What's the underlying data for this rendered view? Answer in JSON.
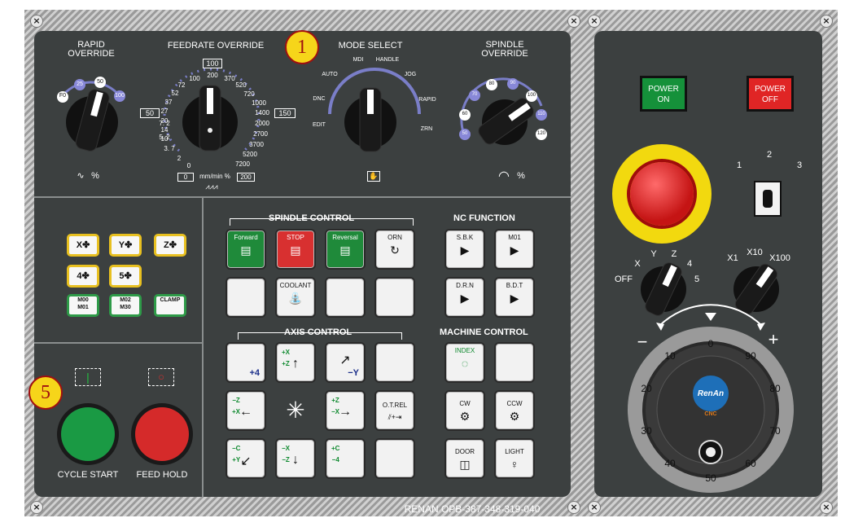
{
  "top_panel": {
    "rapid_override": {
      "title": "RAPID\nOVERRIDE",
      "scale": [
        "F0",
        "25",
        "50",
        "100"
      ],
      "unit": "%"
    },
    "feedrate_override": {
      "title": "FEEDRATE OVERRIDE",
      "top_box": "100",
      "left_box": "50",
      "right_box": "150",
      "left_scale": [
        "72",
        "52",
        "37",
        "27",
        "20",
        "14",
        "10",
        "7. 2",
        "5. 2",
        "3. 7",
        "2",
        "0"
      ],
      "top_scale": [
        "100",
        "200",
        "370",
        "520",
        "720",
        "1000",
        "1400",
        "2000",
        "2700",
        "3700",
        "5200",
        "7200"
      ],
      "bottom_left_box": "0",
      "unit": "mm/min %",
      "bottom_right_box": "200"
    },
    "mode_select": {
      "title": "MODE SELECT",
      "modes": [
        "AUTO",
        "MDI",
        "HANDLE",
        "JOG",
        "RAPID",
        "ZRN",
        "EDIT",
        "DNC"
      ]
    },
    "spindle_override": {
      "title": "SPINDLE\nOVERRIDE",
      "scale": [
        "50",
        "60",
        "70",
        "80",
        "90",
        "100",
        "110",
        "120"
      ],
      "unit": "%"
    }
  },
  "right_panel": {
    "power_on": "POWER\nON",
    "power_off": "POWER\nOFF",
    "key_switch": [
      "1",
      "2",
      "3"
    ],
    "axis_select": [
      "OFF",
      "X",
      "Y",
      "Z",
      "4",
      "5"
    ],
    "mult_select": [
      "X1",
      "X10",
      "X100"
    ],
    "hand_wheel": {
      "minus": "−",
      "plus": "+",
      "brand": "RenAn",
      "sub": "CNC",
      "ticks": [
        "0",
        "10",
        "20",
        "30",
        "40",
        "50",
        "60",
        "70",
        "80",
        "90"
      ]
    }
  },
  "left_lower": {
    "axis_keys": [
      "X",
      "Y",
      "Z",
      "4",
      "5"
    ],
    "m_keys": [
      "M00\nM01",
      "M02\nM30",
      "CLAMP"
    ],
    "cycle_start": "CYCLE START",
    "feed_hold": "FEED HOLD"
  },
  "spindle_control": {
    "title": "SPINDLE CONTROL",
    "keys": [
      "Forward",
      "STOP",
      "Reversal",
      "ORN",
      "",
      "COOLANT",
      "",
      ""
    ]
  },
  "nc_function": {
    "title": "NC FUNCTION",
    "keys": [
      "S.B.K",
      "M01",
      "D.R.N",
      "B.D.T"
    ]
  },
  "axis_control": {
    "title": "AXIS CONTROL",
    "keys": [
      "+4",
      "+X\n+Z",
      "−Y",
      "",
      "−Z\n+X",
      "",
      "+Z\n−X",
      "O.T.REL",
      "−C\n+Y",
      "−X\n−Z",
      "+C\n−4",
      ""
    ]
  },
  "machine_control": {
    "title": "MACHINE CONTROL",
    "keys": [
      "INDEX",
      "",
      "CW",
      "CCW",
      "DOOR",
      "LIGHT"
    ]
  },
  "footer": "RENAN OPB-387-348-319-040",
  "badges": [
    "1",
    "5"
  ]
}
